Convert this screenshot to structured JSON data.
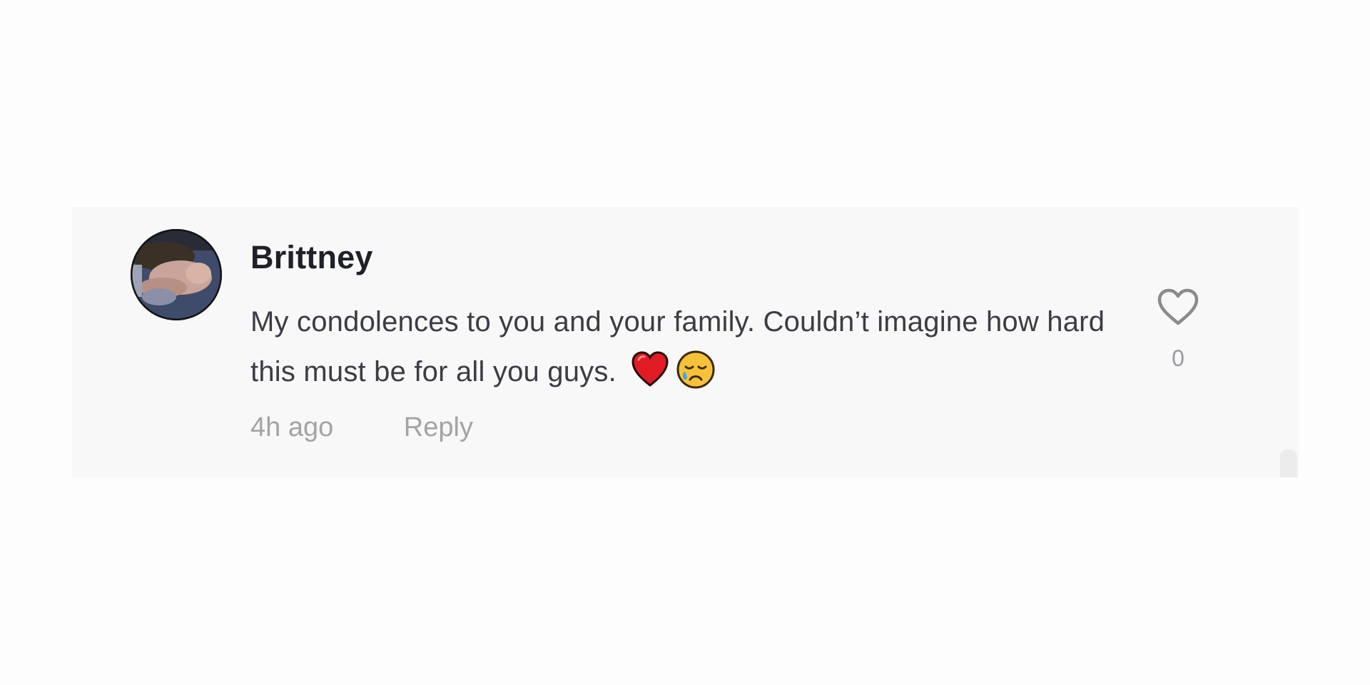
{
  "comment": {
    "username": "Brittney",
    "avatar_icon": "user-avatar-photo",
    "text": "My condolences to you and your family. Couldn’t imagine how hard this must be for all you guys.",
    "emojis": [
      "red-heart",
      "sad-but-relieved-face"
    ],
    "timestamp": "4h ago",
    "reply_label": "Reply",
    "like_icon": "heart-outline-icon",
    "like_count": "0"
  },
  "colors": {
    "card_background": "#f8f8f8",
    "username": "#1f2029",
    "text": "#3b3c44",
    "meta": "#a3a3a8"
  }
}
